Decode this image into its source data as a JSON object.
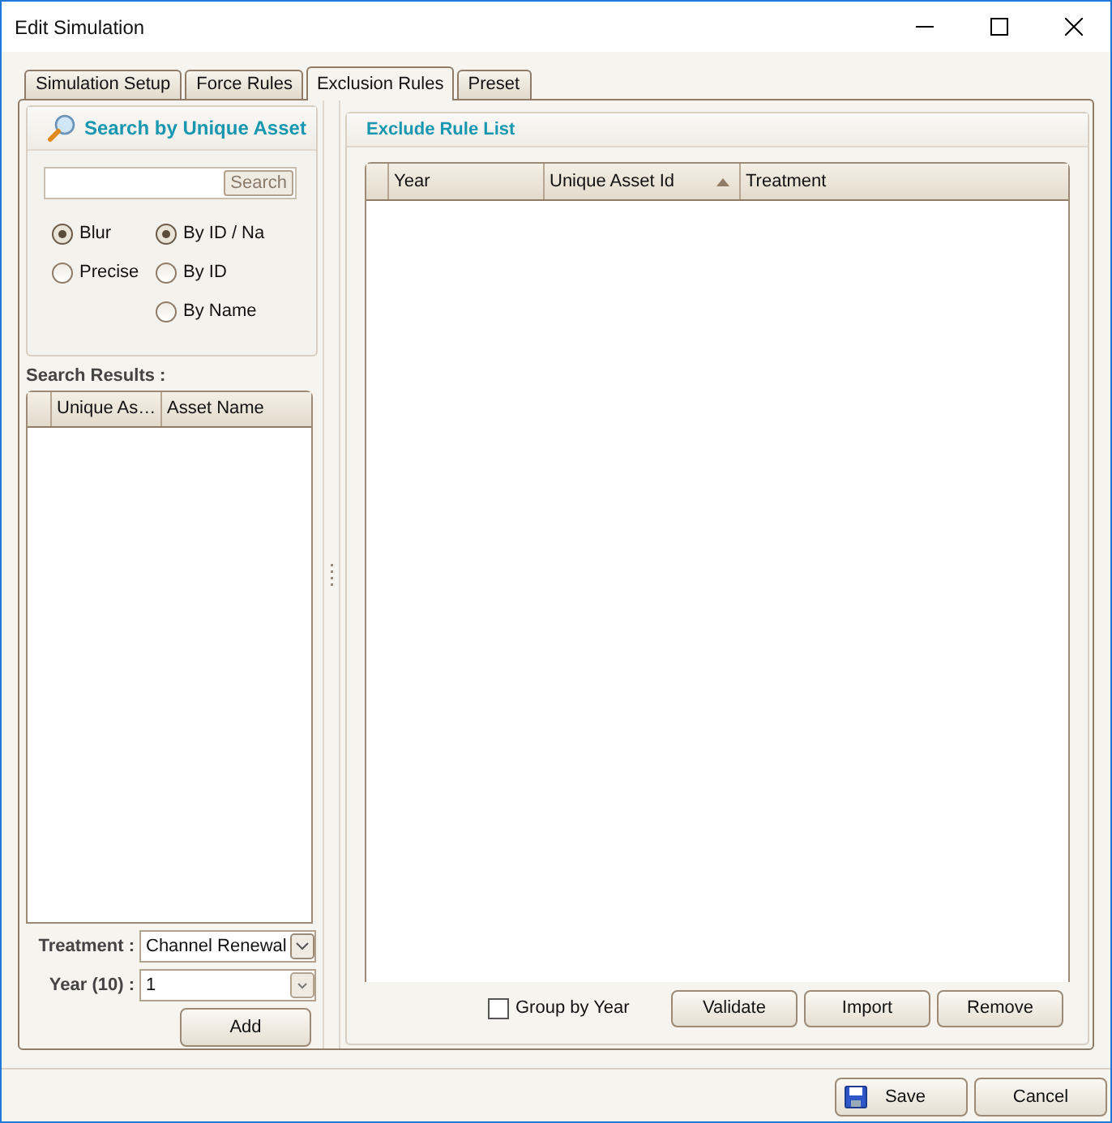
{
  "window": {
    "title": "Edit Simulation"
  },
  "tabs": [
    {
      "label": "Simulation Setup",
      "selected": false
    },
    {
      "label": "Force Rules",
      "selected": false
    },
    {
      "label": "Exclusion Rules",
      "selected": true
    },
    {
      "label": "Preset",
      "selected": false
    }
  ],
  "search_panel": {
    "title": "Search by Unique Asset",
    "search_button": "Search",
    "match_modes": [
      {
        "label": "Blur",
        "selected": true
      },
      {
        "label": "Precise",
        "selected": false
      }
    ],
    "search_by": [
      {
        "label": "By ID / Na",
        "selected": true
      },
      {
        "label": "By ID",
        "selected": false
      },
      {
        "label": "By Name",
        "selected": false
      }
    ]
  },
  "search_results": {
    "label": "Search Results :",
    "columns": [
      "Unique As…",
      "Asset Name"
    ]
  },
  "treatment": {
    "label": "Treatment :",
    "value": "Channel Renewal"
  },
  "year": {
    "label": "Year (10) :",
    "value": "1"
  },
  "add_button": "Add",
  "exclude_panel": {
    "title": "Exclude Rule List",
    "columns": [
      {
        "label": "Year",
        "sorted": false
      },
      {
        "label": "Unique Asset Id",
        "sorted": true
      },
      {
        "label": "Treatment",
        "sorted": false
      }
    ],
    "group_by_year": {
      "label": "Group by Year",
      "checked": false
    },
    "buttons": [
      "Validate",
      "Import",
      "Remove"
    ]
  },
  "footer_buttons": [
    {
      "label": "Save",
      "kind": "save"
    },
    {
      "label": "Cancel",
      "kind": "plain"
    }
  ]
}
